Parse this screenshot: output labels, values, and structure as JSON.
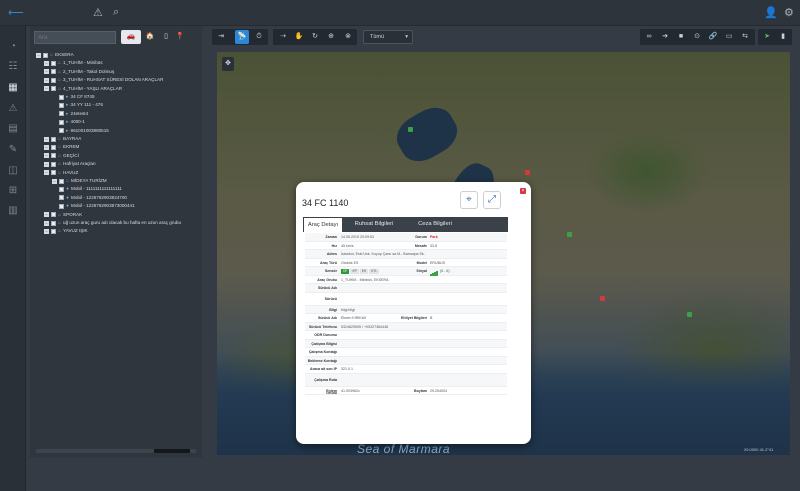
{
  "search": {
    "placeholder": "Ara"
  },
  "filter_buttons": [
    "🚗",
    "🏠",
    "▯",
    "📍"
  ],
  "tree": [
    {
      "label": "EKSERA",
      "level": 0,
      "type": "folder"
    },
    {
      "label": "1_TUHİM - Minibüs",
      "level": 1,
      "type": "group"
    },
    {
      "label": "2_TUHİM - Takol Dolmuş",
      "level": 1,
      "type": "group"
    },
    {
      "label": "3_TUHİM - RUHSAT SÜRESİ DOLAN ARAÇLAR",
      "level": 1,
      "type": "group"
    },
    {
      "label": "4_TUHİM - YAŞLI ARAÇLAR",
      "level": 1,
      "type": "group"
    },
    {
      "label": "34 CF 8745",
      "level": 2,
      "type": "vehicle"
    },
    {
      "label": "34 YY 111 - 476",
      "level": 2,
      "type": "vehicle"
    },
    {
      "label": "24etest4",
      "level": 2,
      "type": "vehicle"
    },
    {
      "label": "4000-1",
      "level": 2,
      "type": "vehicle"
    },
    {
      "label": "861001003880515",
      "level": 2,
      "type": "vehicle"
    },
    {
      "label": "BAYRAA",
      "level": 1,
      "type": "group"
    },
    {
      "label": "EKREM",
      "level": 1,
      "type": "group"
    },
    {
      "label": "GEÇİCİ",
      "level": 1,
      "type": "group"
    },
    {
      "label": "Hafriyat Araçları",
      "level": 1,
      "type": "group"
    },
    {
      "label": "HAVUZ",
      "level": 1,
      "type": "group"
    },
    {
      "label": "MİDEYA TURİZM",
      "level": 2,
      "type": "group"
    },
    {
      "label": "Mobil - 1111111111111111",
      "level": 2,
      "type": "mobile"
    },
    {
      "label": "Mobil - 1226782903824700",
      "level": 2,
      "type": "mobile"
    },
    {
      "label": "Mobil - 1226782903873000441",
      "level": 2,
      "type": "mobile"
    },
    {
      "label": "SPORAK",
      "level": 1,
      "type": "group"
    },
    {
      "label": "uğ uzun araç guru adı olacak bu hafta en uzun araç grubu",
      "level": 1,
      "type": "group"
    },
    {
      "label": "YAVUZ IŞIK",
      "level": 1,
      "type": "group"
    }
  ],
  "toolbar_left": [
    "⇥",
    "📡",
    "⏱",
    "⇢",
    "✋",
    "↻",
    "⊕",
    "⊗"
  ],
  "dropdown": {
    "value": "Tümü"
  },
  "toolbar_right": [
    "∞",
    "➔",
    "■",
    "⊙",
    "🔗",
    "▭",
    "⇆",
    "➤",
    "▮"
  ],
  "popup": {
    "title": "34 FC 1140",
    "tabs": [
      "Araç Detayı",
      "Ruhsat Bilgileri",
      "Ceza Bilgileri"
    ],
    "rows": [
      {
        "label": "Zaman",
        "value": "14.05.2019 20:09:53",
        "label2": "Durum",
        "value2": "Park"
      },
      {
        "label": "Hız",
        "value": "45 km/s",
        "label2": "Mesafe",
        "value2": "33.8"
      },
      {
        "label": "Adres",
        "value": "İstanbul, Eski Usk. Kuyup Çarsı sa M.- Bamcapa Sk.",
        "label2": "",
        "value2": ""
      },
      {
        "label": "Araç Türü",
        "value": "Otobüs ES",
        "label2": "Model",
        "value2": "ERUBUS"
      },
      {
        "label": "Sensör",
        "value": "",
        "label2": "Sinyal",
        "value2": "(6 - 6)"
      },
      {
        "label": "Araç Grubu",
        "value": "1_TUHİM - Minibüs, EKSERA",
        "label2": "",
        "value2": ""
      },
      {
        "label": "Sürücü Adı",
        "value": "",
        "label2": "",
        "value2": ""
      },
      {
        "label": "Sürücü Açıklaması",
        "value": "",
        "label2": "",
        "value2": ""
      },
      {
        "label": "Bilgi",
        "value": "bilgi bilgi",
        "label2": "",
        "value2": ""
      },
      {
        "label": "Sürücü Adı",
        "value": "Ekrem KIRIKAV",
        "label2": "Ehliyet Bilgileri",
        "value2": "B"
      },
      {
        "label": "Sürücü Telefonu",
        "value": "5324629595 / +05327384448",
        "label2": "",
        "value2": ""
      },
      {
        "label": "ODR Durumu",
        "value": "",
        "label2": "",
        "value2": ""
      },
      {
        "label": "Çalışma Bilgisi",
        "value": "",
        "label2": "",
        "value2": ""
      },
      {
        "label": "Çalışma Kontağı",
        "value": "",
        "label2": "",
        "value2": ""
      },
      {
        "label": "Bekleme Kontağı",
        "value": "",
        "label2": "",
        "value2": ""
      },
      {
        "label": "Araca ait son IP",
        "value": "321.0.1",
        "label2": "",
        "value2": ""
      },
      {
        "label": "Çalışma Rota Grubu",
        "value": "",
        "label2": "",
        "value2": ""
      },
      {
        "label": "Enlem",
        "value": "41.003962c",
        "label2": "Boylam",
        "value2": "29.254004"
      }
    ],
    "sensors": [
      "OF",
      "KP",
      "EH",
      "KTL"
    ]
  },
  "map": {
    "sea_label": "Sea of Marmara",
    "scale_text": "29.0000  41.2°41"
  },
  "colors": {
    "accent": "#2b88d8",
    "park_status": "#dd2222",
    "sensor_on": "#2f9a3b"
  }
}
